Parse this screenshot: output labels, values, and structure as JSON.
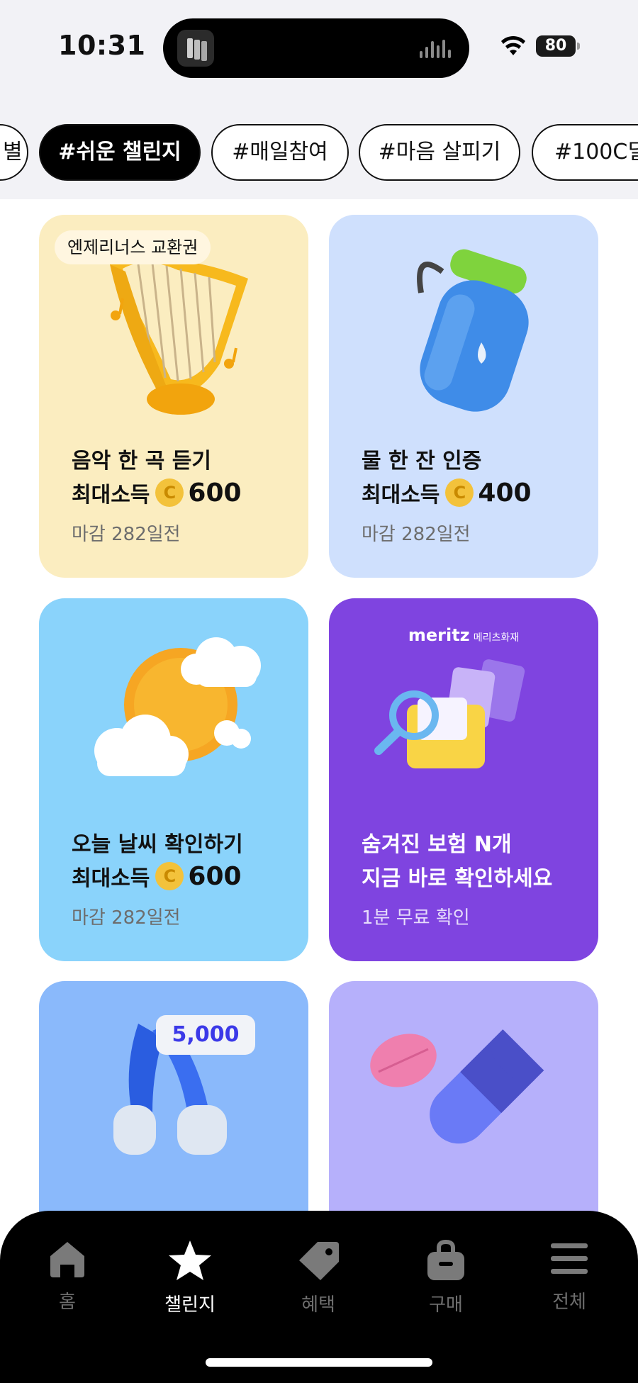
{
  "status_bar": {
    "time": "10:31",
    "battery": "80"
  },
  "tags": [
    {
      "label": "#",
      "partial_text": "별"
    },
    {
      "label": "#쉬운 챌린지",
      "active": true
    },
    {
      "label": "#매일참여"
    },
    {
      "label": "#마음 살피기"
    },
    {
      "label": "#100C딜"
    }
  ],
  "cards": [
    {
      "badge": "엔제리너스 교환권",
      "title": "음악 한 곡 듣기",
      "reward_label": "최대소득",
      "coin": "C",
      "amount": "600",
      "deadline": "마감 282일전",
      "bg": "#fbedc0",
      "icon": "harp-icon"
    },
    {
      "title": "물 한 잔 인증",
      "reward_label": "최대소득",
      "coin": "C",
      "amount": "400",
      "deadline": "마감 282일전",
      "bg": "#cfe0fd",
      "icon": "water-bottle-icon"
    },
    {
      "title": "오늘 날씨 확인하기",
      "reward_label": "최대소득",
      "coin": "C",
      "amount": "600",
      "deadline": "마감 282일전",
      "bg": "#8ad3fb",
      "icon": "sun-cloud-icon"
    },
    {
      "ad_brand": "meritz",
      "ad_brand_sub": "메리츠화재",
      "title": "숨겨진 보험 N개",
      "subtitle": "지금 바로 확인하세요",
      "note": "1분 무료 확인",
      "bg": "#7f44e0",
      "icon": "folder-search-icon"
    },
    {
      "steps": "5,000",
      "bg": "#8ab9fb",
      "icon": "walking-legs-icon"
    },
    {
      "bg": "#b6b0fb",
      "icon": "pills-icon"
    }
  ],
  "nav": [
    {
      "label": "홈",
      "icon": "home-icon"
    },
    {
      "label": "챌린지",
      "icon": "star-icon",
      "active": true
    },
    {
      "label": "혜택",
      "icon": "tag-icon"
    },
    {
      "label": "구매",
      "icon": "shopping-bag-icon"
    },
    {
      "label": "전체",
      "icon": "menu-icon"
    }
  ]
}
